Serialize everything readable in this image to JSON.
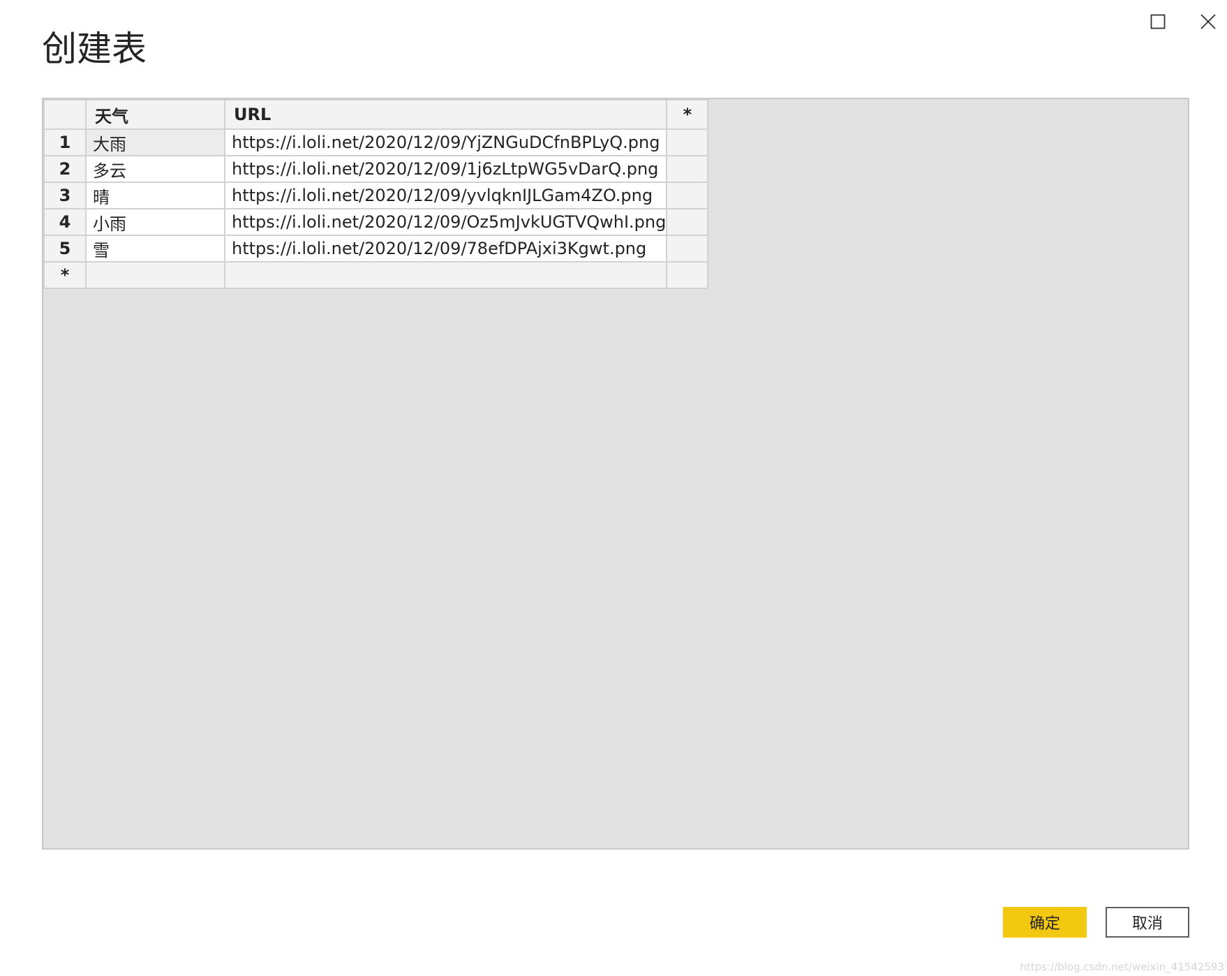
{
  "dialog": {
    "title": "创建表",
    "ok_label": "确定",
    "cancel_label": "取消"
  },
  "table": {
    "headers": {
      "rownum": "",
      "col1": "天气",
      "col2": "URL",
      "add": "*"
    },
    "rows": [
      {
        "num": "1",
        "weather": "大雨",
        "url": "https://i.loli.net/2020/12/09/YjZNGuDCfnBPLyQ.png"
      },
      {
        "num": "2",
        "weather": "多云",
        "url": "https://i.loli.net/2020/12/09/1j6zLtpWG5vDarQ.png"
      },
      {
        "num": "3",
        "weather": "晴",
        "url": "https://i.loli.net/2020/12/09/yvlqknIJLGam4ZO.png"
      },
      {
        "num": "4",
        "weather": "小雨",
        "url": "https://i.loli.net/2020/12/09/Oz5mJvkUGTVQwhI.png"
      },
      {
        "num": "5",
        "weather": "雪",
        "url": "https://i.loli.net/2020/12/09/78efDPAjxi3Kgwt.png"
      }
    ],
    "new_row_marker": "*"
  },
  "icons": {
    "maximize": "maximize-icon",
    "close": "close-icon"
  },
  "colors": {
    "accent": "#f2c811",
    "grid_bg": "#e1e1e1"
  },
  "watermark": "https://blog.csdn.net/weixin_41542593"
}
